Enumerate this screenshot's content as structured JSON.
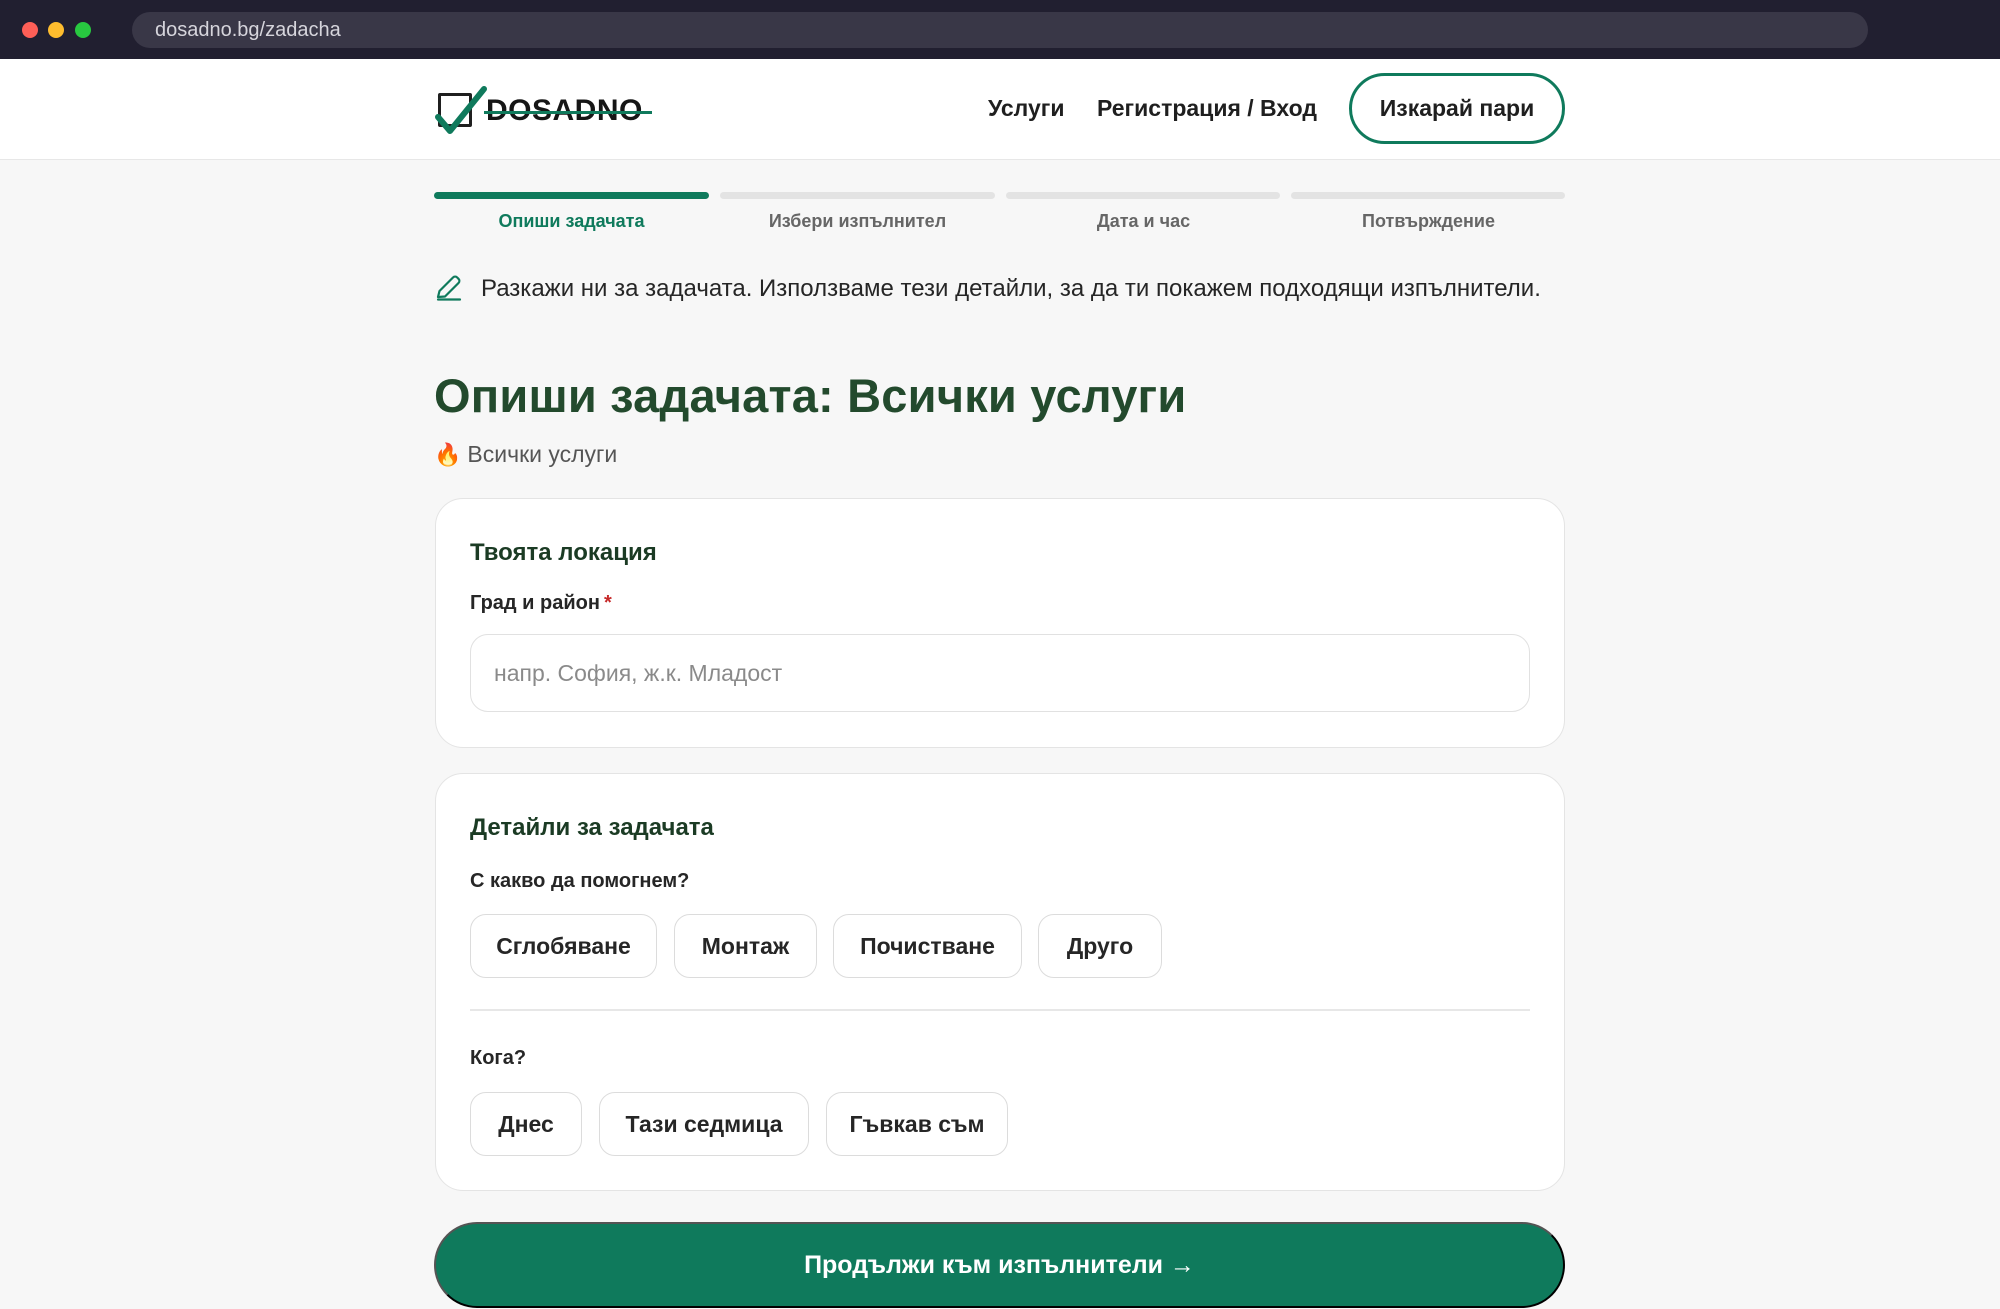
{
  "browser": {
    "url": "dosadno.bg/zadacha"
  },
  "header": {
    "logo_text": "DOSADNO",
    "nav": [
      {
        "label": "Услуги"
      },
      {
        "label": "Регистрация / Вход"
      }
    ],
    "earn_button": "Изкарай пари"
  },
  "steps": [
    {
      "label": "Опиши задачата",
      "active": true
    },
    {
      "label": "Избери изпълнител",
      "active": false
    },
    {
      "label": "Дата и час",
      "active": false
    },
    {
      "label": "Потвърждение",
      "active": false
    }
  ],
  "intro": "Разкажи ни за задачата. Използваме тези детайли, за да ти покажем подходящи изпълнители.",
  "title": "Опиши задачата: Всички услуги",
  "subtitle": "Всички услуги",
  "location": {
    "heading": "Твоята локация",
    "field_label": "Град и район",
    "required_mark": "*",
    "placeholder": "напр. София, ж.к. Младост",
    "value": ""
  },
  "details": {
    "heading": "Детайли за задачата",
    "help_question": "С какво да помогнем?",
    "help_options": [
      "Сглобяване",
      "Монтаж",
      "Почистване",
      "Друго"
    ],
    "when_question": "Кога?",
    "when_options": [
      "Днес",
      "Тази седмица",
      "Гъвкав съм"
    ]
  },
  "continue_button": "Продължи към изпълнители →",
  "colors": {
    "brand": "#0f7a5c",
    "title": "#234a2d"
  },
  "icons": {
    "edit": "pencil-icon",
    "subtitle": "flame-icon",
    "logo": "checkbox-check-icon"
  }
}
